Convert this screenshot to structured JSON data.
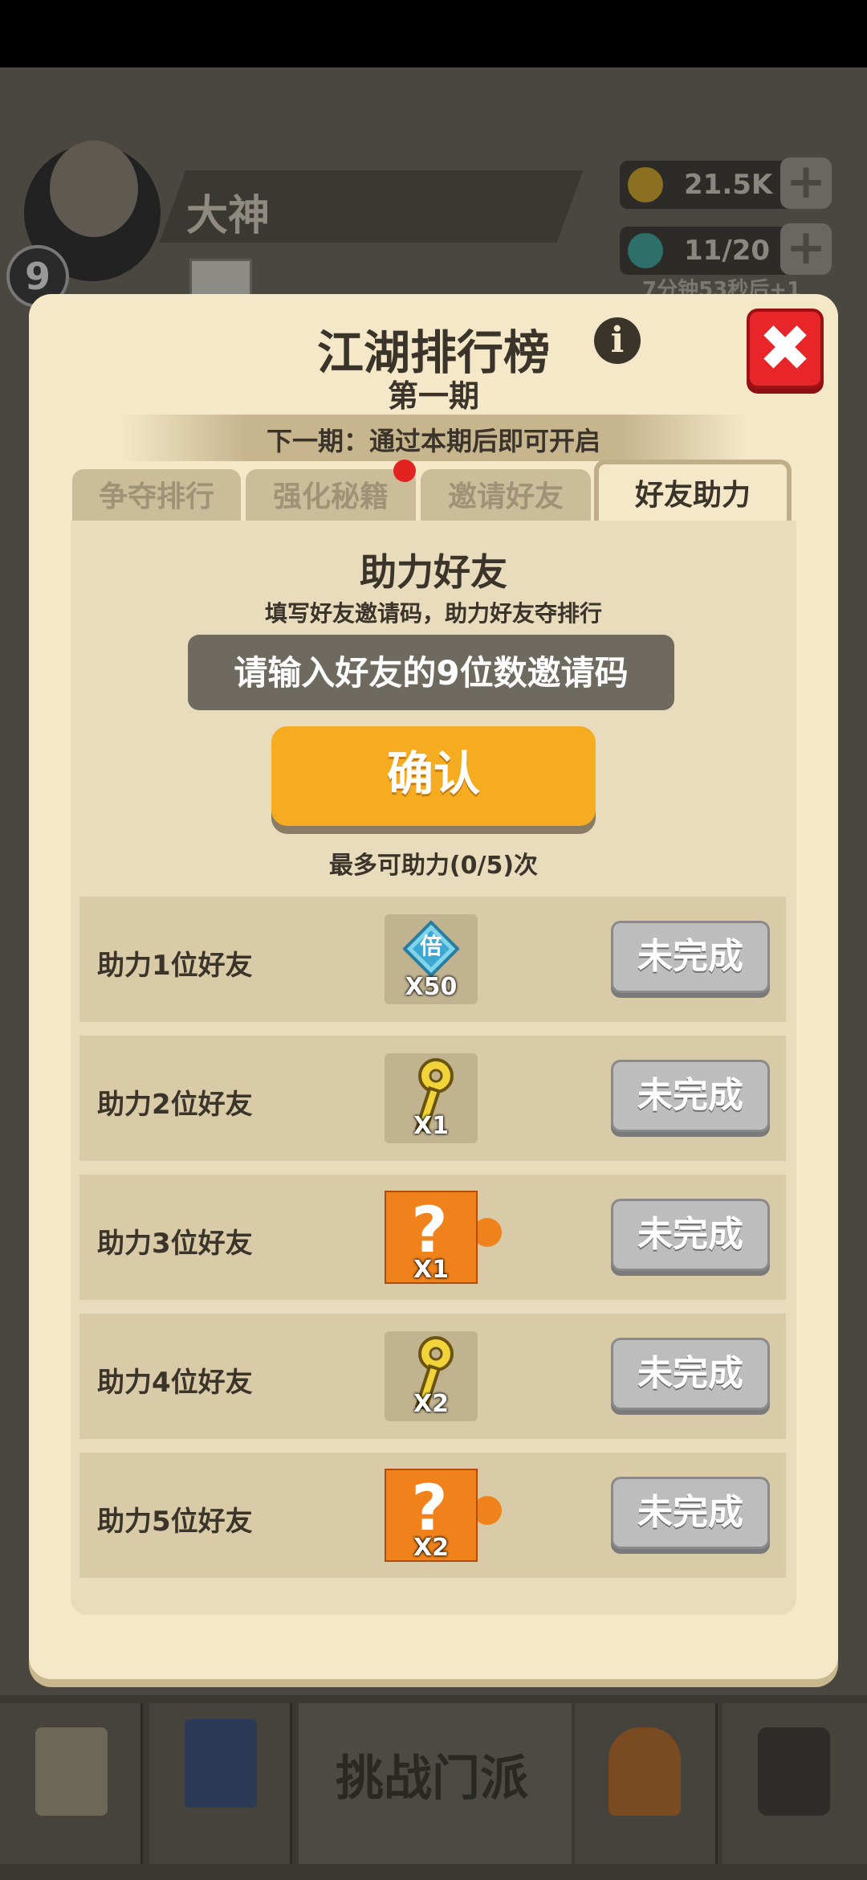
{
  "background": {
    "player_name": "大神",
    "level": "9",
    "gold": "21.5K",
    "gems": "11/20",
    "timer": "7分钟53秒后+1",
    "nav_center_label": "挑战门派"
  },
  "dialog": {
    "title": "江湖排行榜",
    "subtitle": "第一期",
    "notice": "下一期：通过本期后即可开启",
    "tabs": [
      {
        "label": "争夺排行"
      },
      {
        "label": "强化秘籍"
      },
      {
        "label": "邀请好友"
      },
      {
        "label": "好友助力"
      }
    ],
    "help": {
      "title": "助力好友",
      "description": "填写好友邀请码，助力好友夺排行",
      "input_placeholder": "请输入好友的9位数邀请码",
      "confirm_label": "确认",
      "limit_text": "最多可助力(0/5)次"
    },
    "rewards": [
      {
        "label": "助力1位好友",
        "item_icon": "multiplier-gem-icon",
        "count": "X50",
        "status": "未完成"
      },
      {
        "label": "助力2位好友",
        "item_icon": "golden-key-icon",
        "count": "X1",
        "status": "未完成"
      },
      {
        "label": "助力3位好友",
        "item_icon": "mystery-puzzle-icon",
        "count": "X1",
        "status": "未完成"
      },
      {
        "label": "助力4位好友",
        "item_icon": "golden-key-icon",
        "count": "X2",
        "status": "未完成"
      },
      {
        "label": "助力5位好友",
        "item_icon": "mystery-puzzle-icon",
        "count": "X2",
        "status": "未完成"
      }
    ],
    "multiplier_glyph": "倍",
    "colors": {
      "dialog_bg": "#f4e8c9",
      "confirm_orange": "#f5ac21",
      "close_red": "#e8262a",
      "pending_gray": "#bdbdbd"
    }
  }
}
